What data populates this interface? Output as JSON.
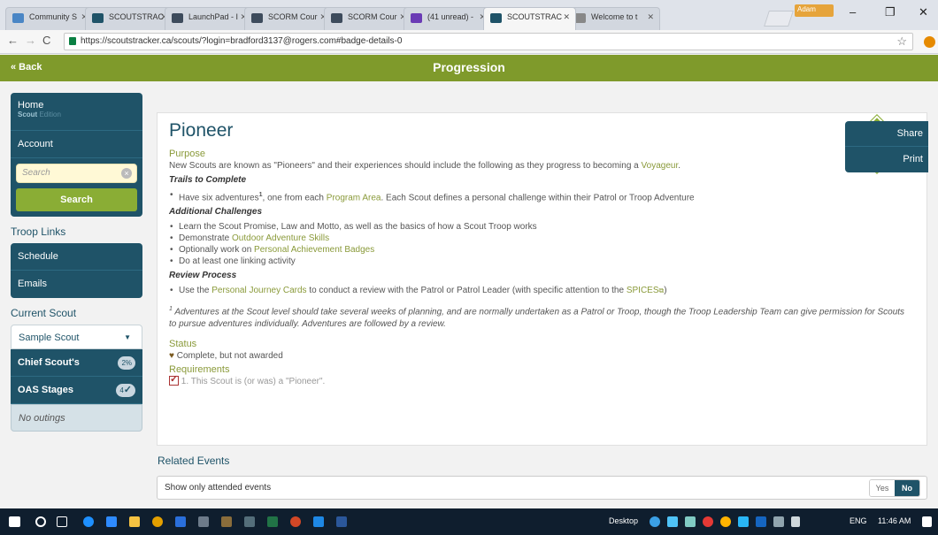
{
  "browser": {
    "tabs": [
      {
        "label": "Community S",
        "color": "#4a86c5"
      },
      {
        "label": "SCOUTSTRAC",
        "color": "#1f5368"
      },
      {
        "label": "LaunchPad - I",
        "color": "#3d4b5c"
      },
      {
        "label": "SCORM Cour",
        "color": "#3d4b5c"
      },
      {
        "label": "SCORM Cour",
        "color": "#3d4b5c"
      },
      {
        "label": "(41 unread) -",
        "color": "#6a3bb5"
      },
      {
        "label": "SCOUTSTRAC",
        "color": "#1f5368"
      },
      {
        "label": "Welcome to t",
        "color": "#888888"
      }
    ],
    "user_badge": "Adam",
    "url": "https://scoutstracker.ca/scouts/?login=bradford3137@rogers.com#badge-details-0"
  },
  "topbar": {
    "back_label": "« Back",
    "title": "Progression"
  },
  "sidebar": {
    "home": "Home",
    "edition_scout": "Scout",
    "edition_label": "Edition",
    "account": "Account",
    "search_placeholder": "Search",
    "search_button": "Search",
    "troop_links_title": "Troop Links",
    "troop_links": [
      "Schedule",
      "Emails"
    ],
    "current_scout_title": "Current Scout",
    "current_scout_value": "Sample Scout",
    "stages": [
      {
        "label": "Chief Scout's",
        "badge": "2%"
      },
      {
        "label": "OAS Stages",
        "badge": "4",
        "badge_check": "✓"
      }
    ],
    "no_outings": "No outings"
  },
  "badge": {
    "title": "Pioneer",
    "purpose_label": "Purpose",
    "purpose_text": "New Scouts are known as \"Pioneers\" and their experiences should include the following as they progress to becoming a",
    "purpose_link": "Voyageur",
    "trails_label": "Trails to Complete",
    "trails_item_a": "Have six adventures",
    "trails_item_sup": "1",
    "trails_item_b": ", one from each",
    "trails_item_link": "Program Area",
    "trails_item_c": ". Each Scout defines a personal challenge within their Patrol or Troop Adventure",
    "additional_label": "Additional Challenges",
    "add_1": "Learn the Scout Promise, Law and Motto, as well as the basics of how a Scout Troop works",
    "add_2_text": "Demonstrate",
    "add_2_link": "Outdoor Adventure Skills",
    "add_3_text": "Optionally work on",
    "add_3_link": "Personal Achievement Badges",
    "add_4": "Do at least one linking activity",
    "review_label": "Review Process",
    "review_a": "Use the",
    "review_link1": "Personal Journey Cards",
    "review_b": "to conduct a review with the Patrol or Patrol Leader (with specific attention to the",
    "review_link2": "SPICES",
    "review_c": ")",
    "footnote_sup": "1",
    "footnote": "Adventures at the Scout level should take several weeks of planning, and are normally undertaken as a Patrol or Troop, though the Troop Leadership Team can give permission for Scouts to pursue adventures individually. Adventures are followed by a review.",
    "status_label": "Status",
    "status_text": "Complete, but not awarded",
    "requirements_label": "Requirements",
    "requirement_1": "1. This Scout is (or was) a \"Pioneer\"."
  },
  "actions": {
    "share": "Share",
    "print": "Print"
  },
  "related": {
    "title": "Related Events",
    "filter_label": "Show only attended events",
    "yes": "Yes",
    "no": "No"
  },
  "taskbar": {
    "desktop": "Desktop",
    "lang": "ENG",
    "time": "11:46 AM"
  }
}
